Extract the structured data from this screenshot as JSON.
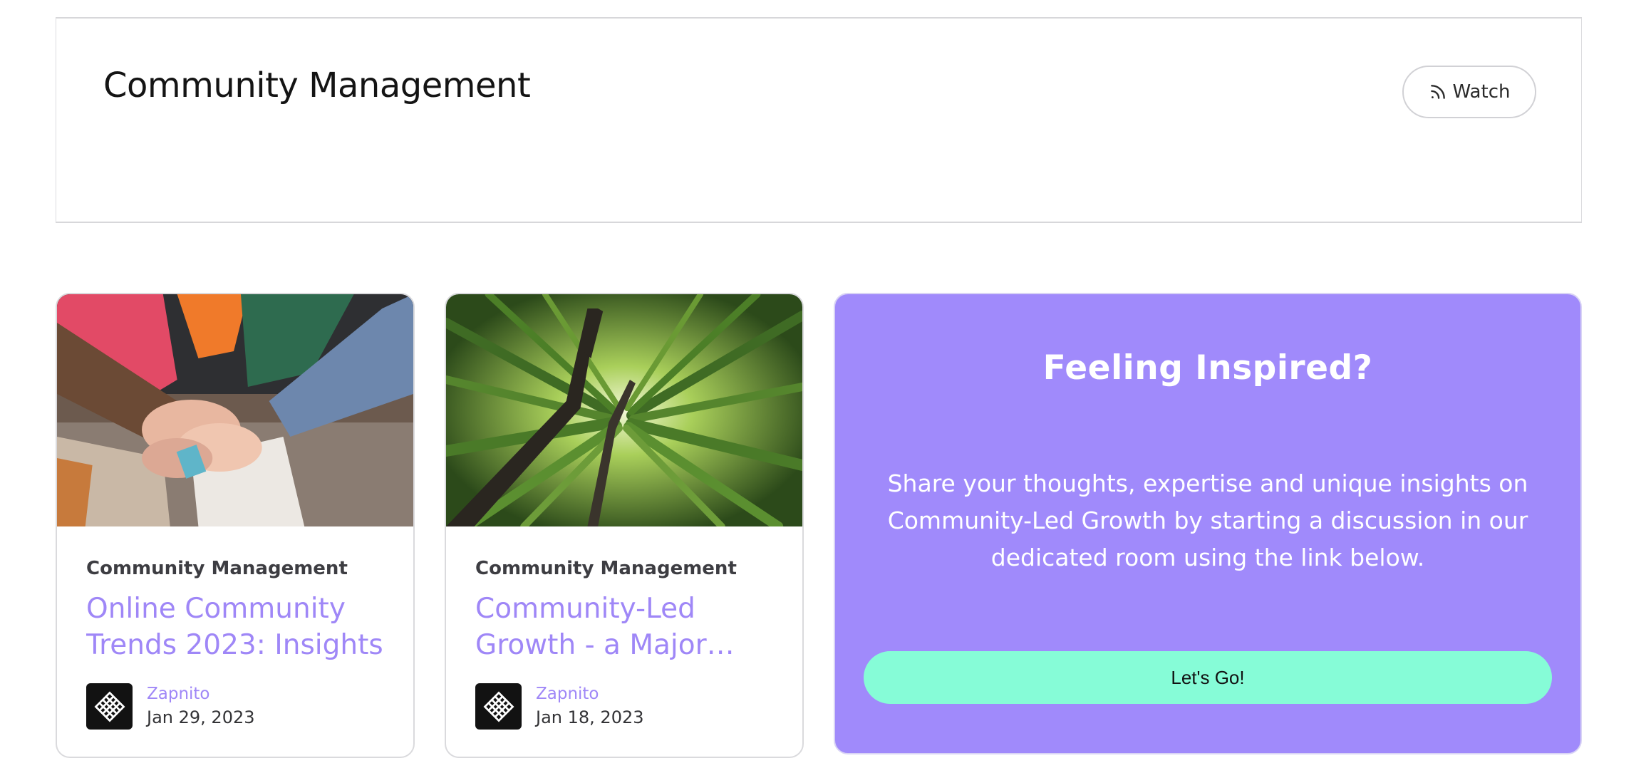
{
  "header": {
    "title": "Community Management",
    "watch_label": "Watch"
  },
  "articles": [
    {
      "category": "Community Management",
      "title": "Online Community Trends 2023: Insights",
      "author": "Zapnito",
      "date": "Jan 29, 2023",
      "image": "hands-stacked-together-photo"
    },
    {
      "category": "Community Management",
      "title": "Community-Led Growth - a Major Shift",
      "author": "Zapnito",
      "date": "Jan 18, 2023",
      "image": "bamboo-forest-photo"
    }
  ],
  "cta": {
    "title": "Feeling Inspired?",
    "body": "Share your thoughts, expertise and unique insights on Community-Led Growth by starting a discussion in our dedicated room using the link below.",
    "button_label": "Let's Go!"
  },
  "colors": {
    "accent_purple": "#a08afb",
    "link_purple": "#9f87f7",
    "cta_button": "#86fcd7"
  },
  "icons": {
    "watch": "rss-feed-icon",
    "avatar": "zapnito-logo-icon"
  }
}
